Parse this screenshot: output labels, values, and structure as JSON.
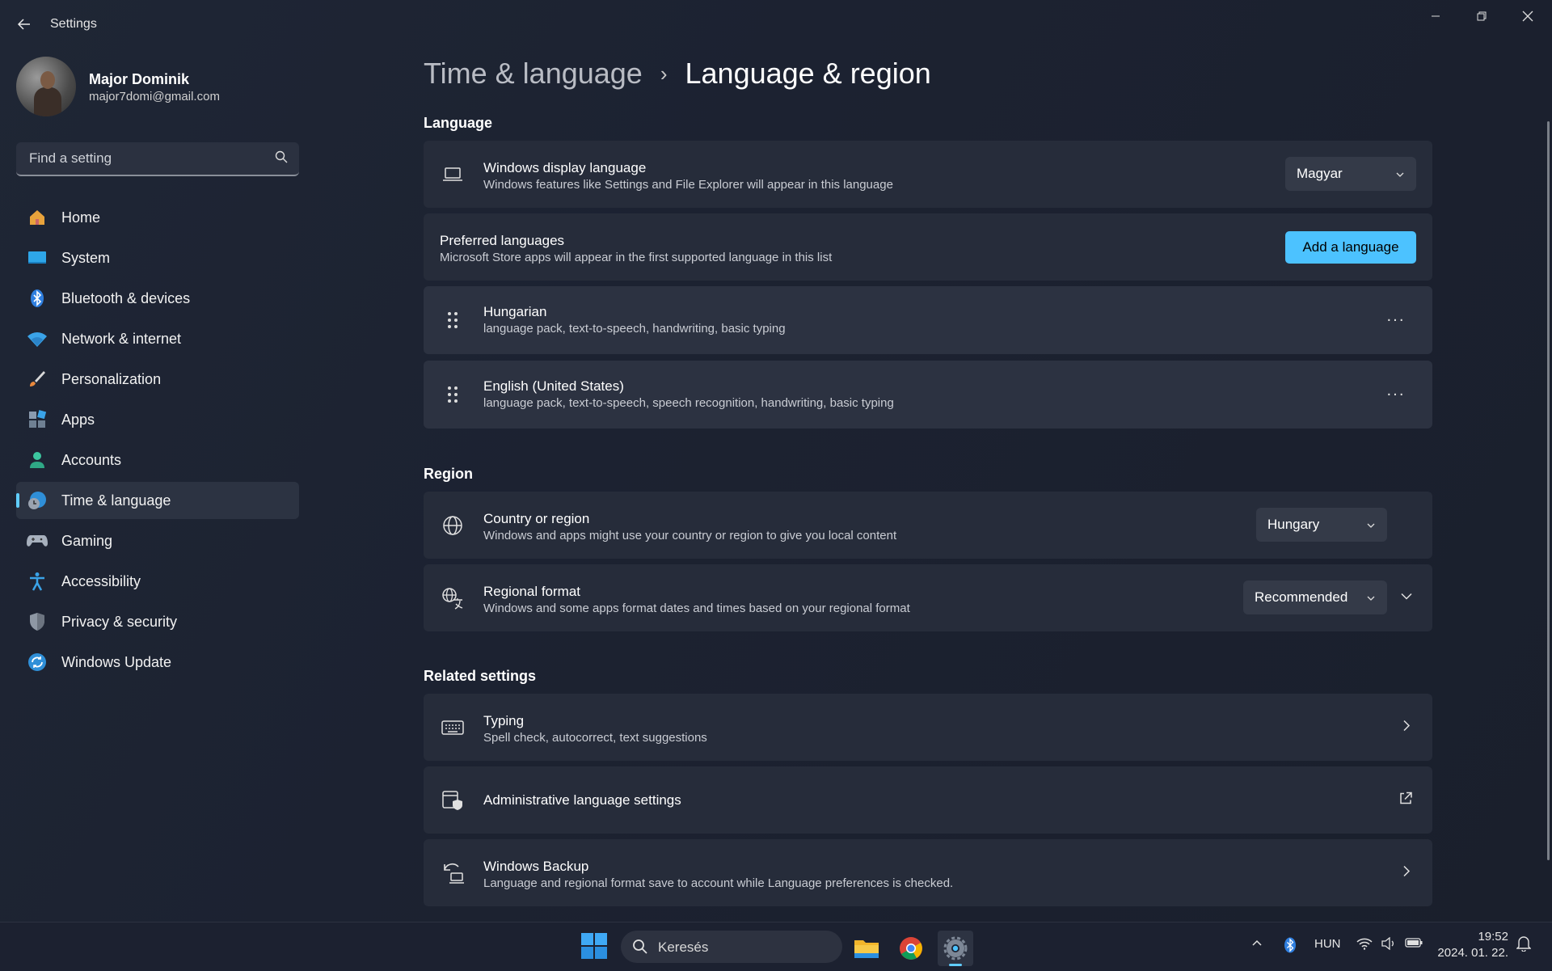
{
  "window": {
    "title": "Settings",
    "back_icon": "back-arrow-icon",
    "controls": [
      "minimize-icon",
      "restore-icon",
      "close-icon"
    ]
  },
  "profile": {
    "name": "Major Dominik",
    "email": "major7domi@gmail.com"
  },
  "search": {
    "placeholder": "Find a setting",
    "icon": "search-icon"
  },
  "sidebar": {
    "items": [
      {
        "label": "Home",
        "icon": "home-icon"
      },
      {
        "label": "System",
        "icon": "system-icon"
      },
      {
        "label": "Bluetooth & devices",
        "icon": "bluetooth-icon"
      },
      {
        "label": "Network & internet",
        "icon": "wifi-icon"
      },
      {
        "label": "Personalization",
        "icon": "brush-icon"
      },
      {
        "label": "Apps",
        "icon": "apps-icon"
      },
      {
        "label": "Accounts",
        "icon": "account-icon"
      },
      {
        "label": "Time & language",
        "icon": "globe-clock-icon",
        "active": true
      },
      {
        "label": "Gaming",
        "icon": "gamepad-icon"
      },
      {
        "label": "Accessibility",
        "icon": "accessibility-icon"
      },
      {
        "label": "Privacy & security",
        "icon": "shield-icon"
      },
      {
        "label": "Windows Update",
        "icon": "update-icon"
      }
    ]
  },
  "breadcrumb": {
    "parent": "Time & language",
    "separator": "›",
    "current": "Language & region"
  },
  "language": {
    "heading": "Language",
    "display_language": {
      "title": "Windows display language",
      "desc": "Windows features like Settings and File Explorer will appear in this language",
      "value": "Magyar",
      "icon": "laptop-icon"
    },
    "preferred": {
      "title": "Preferred languages",
      "desc": "Microsoft Store apps will appear in the first supported language in this list",
      "button": "Add a language"
    },
    "languages": [
      {
        "name": "Hungarian",
        "features": "language pack, text-to-speech, handwriting, basic typing",
        "more": "···"
      },
      {
        "name": "English (United States)",
        "features": "language pack, text-to-speech, speech recognition, handwriting, basic typing",
        "more": "···"
      }
    ]
  },
  "region": {
    "heading": "Region",
    "country": {
      "title": "Country or region",
      "desc": "Windows and apps might use your country or region to give you local content",
      "value": "Hungary",
      "icon": "globe-icon"
    },
    "format": {
      "title": "Regional format",
      "desc": "Windows and some apps format dates and times based on your regional format",
      "value": "Recommended",
      "icon": "regional-format-icon"
    }
  },
  "related": {
    "heading": "Related settings",
    "items": [
      {
        "title": "Typing",
        "desc": "Spell check, autocorrect, text suggestions",
        "icon": "keyboard-icon",
        "action": "chevron-right-icon"
      },
      {
        "title": "Administrative language settings",
        "desc": "",
        "icon": "admin-language-icon",
        "action": "external-link-icon"
      },
      {
        "title": "Windows Backup",
        "desc": "Language and regional format save to account while Language preferences is checked.",
        "icon": "backup-icon",
        "action": "chevron-right-icon"
      }
    ]
  },
  "taskbar": {
    "search_label": "Keresés",
    "apps": [
      "file-explorer-icon",
      "chrome-icon",
      "settings-icon"
    ],
    "tray": {
      "language": "HUN",
      "time": "19:52",
      "date": "2024. 01. 22."
    }
  },
  "colors": {
    "accent": "#4cc2ff",
    "background": "#1f2635",
    "card": "#262c3a"
  }
}
